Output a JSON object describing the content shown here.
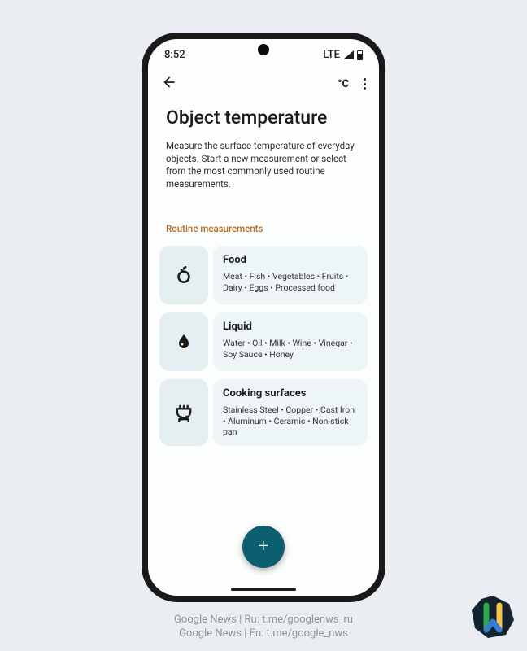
{
  "status": {
    "time": "8:52",
    "network": "LTE"
  },
  "appbar": {
    "temp_unit": "°C"
  },
  "page": {
    "title": "Object temperature",
    "description": "Measure the surface temperature of everyday objects. Start a new measurement or select from the most commonly used routine measurements."
  },
  "section_label": "Routine measurements",
  "cards": [
    {
      "title": "Food",
      "text": "Meat • Fish • Vegetables • Fruits • Dairy • Eggs • Processed food"
    },
    {
      "title": "Liquid",
      "text": "Water • Oil • Milk • Wine • Vinegar • Soy Sauce • Honey"
    },
    {
      "title": "Cooking surfaces",
      "text": "Stainless Steel • Copper • Cast Iron • Aluminum • Ceramic • Non-stick pan"
    }
  ],
  "fab": {
    "label": "+"
  },
  "caption": {
    "line1": "Google News | Ru: t.me/googlenws_ru",
    "line2": "Google News | En: t.me/google_nws"
  }
}
